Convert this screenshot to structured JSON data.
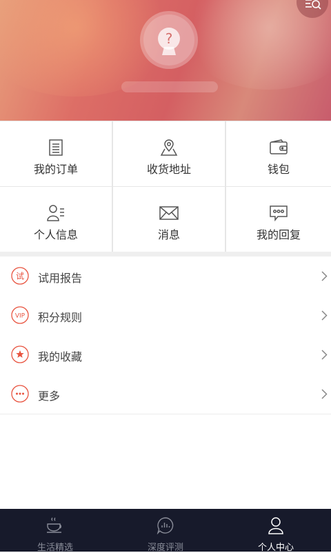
{
  "grid": [
    {
      "label": "我的订单",
      "icon": "order-list-icon"
    },
    {
      "label": "收货地址",
      "icon": "map-location-icon"
    },
    {
      "label": "钱包",
      "icon": "wallet-icon"
    },
    {
      "label": "个人信息",
      "icon": "profile-card-icon"
    },
    {
      "label": "消息",
      "icon": "envelope-icon"
    },
    {
      "label": "我的回复",
      "icon": "reply-bubble-icon"
    }
  ],
  "list": [
    {
      "label": "试用报告",
      "badge": "试",
      "icon": "trial-report-icon"
    },
    {
      "label": "积分规则",
      "badge": "VIP",
      "icon": "vip-icon"
    },
    {
      "label": "我的收藏",
      "icon": "star-icon"
    },
    {
      "label": "更多",
      "icon": "more-dots-icon"
    }
  ],
  "tabs": [
    {
      "label": "生活精选",
      "icon": "coffee-cup-icon",
      "active": false
    },
    {
      "label": "深度评测",
      "icon": "chart-bubble-icon",
      "active": false
    },
    {
      "label": "个人中心",
      "icon": "person-icon",
      "active": true
    }
  ],
  "colors": {
    "accent": "#e8533f",
    "tabbar_bg": "#171a2b"
  }
}
